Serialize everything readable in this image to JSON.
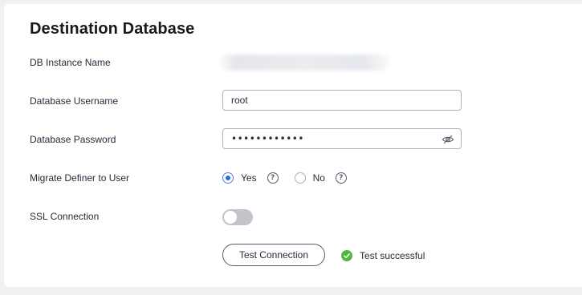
{
  "section": {
    "title": "Destination Database"
  },
  "fields": {
    "instance_name_label": "DB Instance Name",
    "username_label": "Database Username",
    "username_value": "root",
    "password_label": "Database Password",
    "password_value": "••••••••••••",
    "definer_label": "Migrate Definer to User",
    "definer_options": [
      {
        "label": "Yes",
        "selected": true
      },
      {
        "label": "No",
        "selected": false
      }
    ],
    "ssl_label": "SSL Connection",
    "ssl_enabled": false
  },
  "actions": {
    "test_button": "Test Connection",
    "test_status": "Test successful"
  },
  "colors": {
    "accent": "#1e6fd9",
    "success": "#50b83c",
    "toggle_off": "#c2c5cc"
  },
  "icons": {
    "password_toggle": "eye-slash-icon",
    "help": "question-circle-icon",
    "success": "check-circle-icon"
  }
}
